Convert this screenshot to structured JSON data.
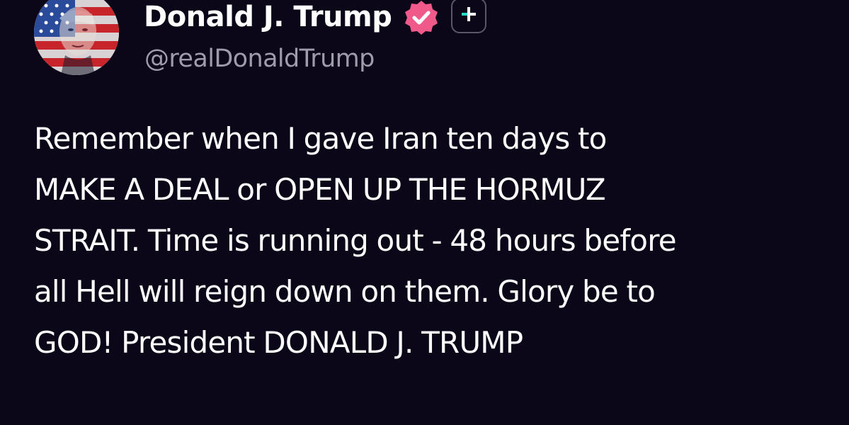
{
  "author": {
    "display_name": "Donald J. Trump",
    "handle": "@realDonaldTrump"
  },
  "icons": {
    "avatar": "profile-picture-flag-portrait",
    "verified": "verified-badge-icon",
    "follow": "plus-icon"
  },
  "colors": {
    "background": "#0b0719",
    "verified_badge": "#f05a8a",
    "accent_follow": "#2ad6c8",
    "handle_text": "#9e9caa"
  },
  "post": {
    "lines": [
      "Remember when I gave Iran ten days to",
      "MAKE A DEAL or OPEN UP THE HORMUZ",
      "STRAIT. Time is running out - 48 hours before",
      "all Hell will reign down on them. Glory be to",
      "GOD! President DONALD J. TRUMP"
    ]
  }
}
